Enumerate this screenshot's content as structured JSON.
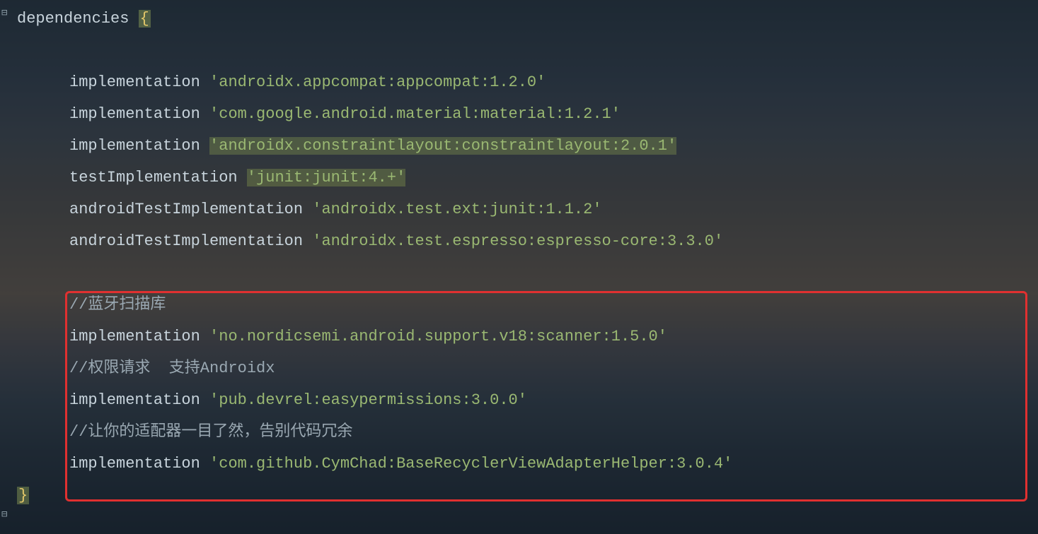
{
  "code": {
    "l1_keyword": "dependencies",
    "l1_brace": "{",
    "l3_kw": "implementation",
    "l3_str": "'androidx.appcompat:appcompat:1.2.0'",
    "l4_kw": "implementation",
    "l4_str": "'com.google.android.material:material:1.2.1'",
    "l5_kw": "implementation",
    "l5_str": "'androidx.constraintlayout:constraintlayout:2.0.1'",
    "l6_kw": "testImplementation",
    "l6_str": "'junit:junit:4.+'",
    "l7_kw": "androidTestImplementation",
    "l7_str": "'androidx.test.ext:junit:1.1.2'",
    "l8_kw": "androidTestImplementation",
    "l8_str": "'androidx.test.espresso:espresso-core:3.3.0'",
    "l10_cmt": "//蓝牙扫描库",
    "l11_kw": "implementation",
    "l11_str": "'no.nordicsemi.android.support.v18:scanner:1.5.0'",
    "l12_cmt": "//权限请求  支持Androidx",
    "l13_kw": "implementation",
    "l13_str": "'pub.devrel:easypermissions:3.0.0'",
    "l14_cmt": "//让你的适配器一目了然，告别代码冗余",
    "l15_kw": "implementation",
    "l15_str": "'com.github.CymChad:BaseRecyclerViewAdapterHelper:3.0.4'",
    "l16_brace": "}"
  }
}
